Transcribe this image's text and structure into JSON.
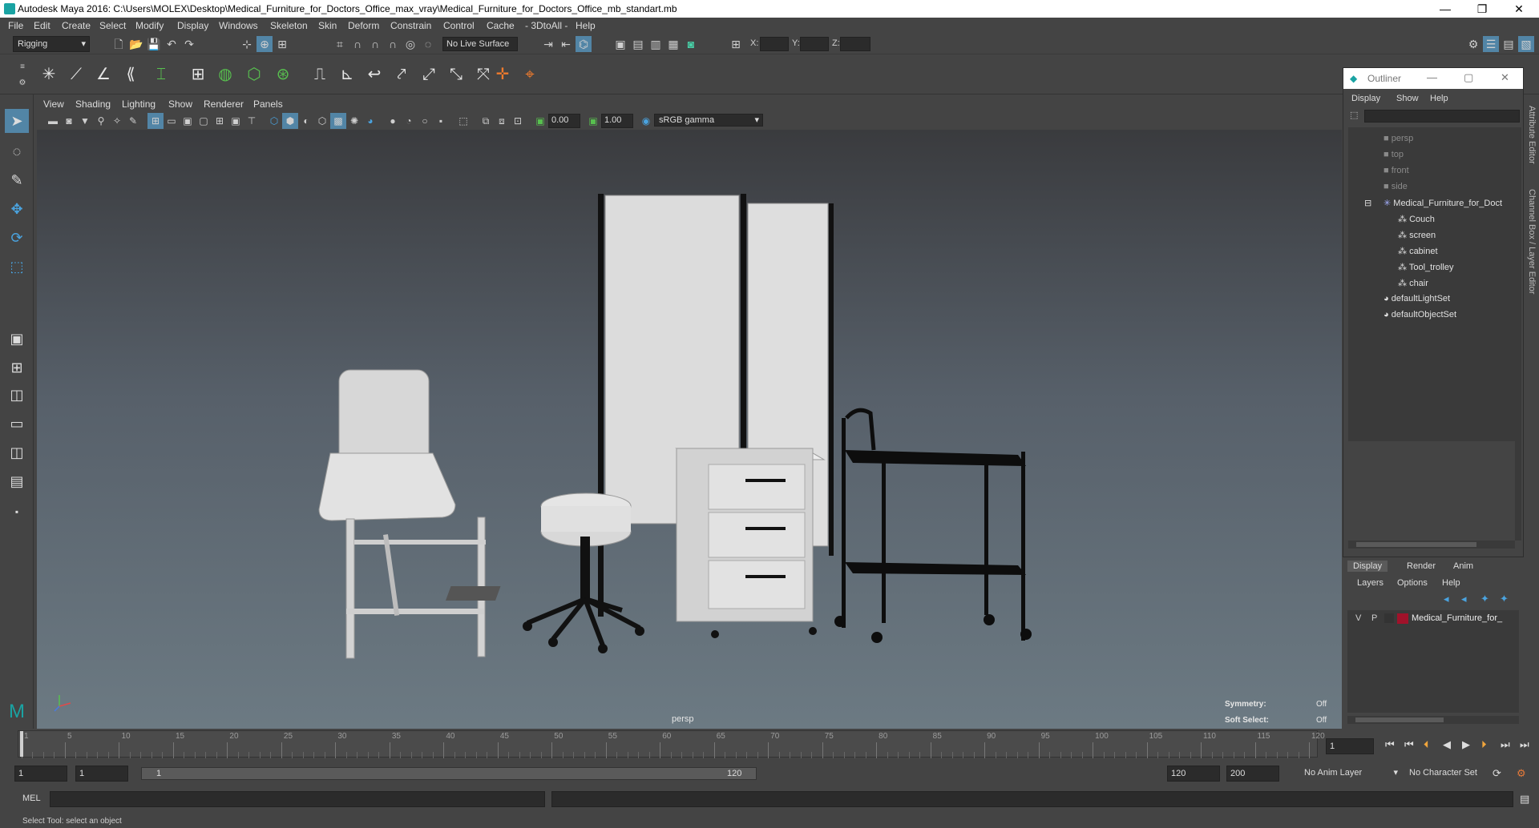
{
  "window": {
    "title": "Autodesk Maya 2016: C:\\Users\\MOLEX\\Desktop\\Medical_Furniture_for_Doctors_Office_max_vray\\Medical_Furniture_for_Doctors_Office_mb_standart.mb",
    "minimize": "—",
    "maximize": "❐",
    "close": "✕"
  },
  "menus": [
    "File",
    "Edit",
    "Create",
    "Select",
    "Modify",
    "Display",
    "Windows",
    "Skeleton",
    "Skin",
    "Deform",
    "Constrain",
    "Control",
    "Cache",
    "- 3DtoAll -",
    "Help"
  ],
  "statusline": {
    "menuset": "Rigging",
    "live_surface": "No Live Surface",
    "x_label": "X:",
    "y_label": "Y:",
    "z_label": "Z:"
  },
  "panel": {
    "menus": [
      "View",
      "Shading",
      "Lighting",
      "Show",
      "Renderer",
      "Panels"
    ],
    "exposure": "0.00",
    "gamma": "1.00",
    "colorspace": "sRGB gamma"
  },
  "viewport": {
    "camera_label": "persp",
    "symmetry_label": "Symmetry:",
    "symmetry_value": "Off",
    "softselect_label": "Soft Select:",
    "softselect_value": "Off"
  },
  "outliner": {
    "title": "Outliner",
    "menus": [
      "Display",
      "Show",
      "Help"
    ],
    "cameras": [
      "persp",
      "top",
      "front",
      "side"
    ],
    "group": "Medical_Furniture_for_Doct",
    "children": [
      "Couch",
      "screen",
      "cabinet",
      "Tool_trolley",
      "chair"
    ],
    "sets": [
      "defaultLightSet",
      "defaultObjectSet"
    ]
  },
  "layers": {
    "tabs": [
      "Display",
      "Render",
      "Anim"
    ],
    "menus": [
      "Layers",
      "Options",
      "Help"
    ],
    "layer_v": "V",
    "layer_p": "P",
    "layer_name": "Medical_Furniture_for_",
    "layer_color": "#a0122a"
  },
  "side_tabs": [
    "Attribute Editor",
    "Channel Box / Layer Editor"
  ],
  "timeline": {
    "ticks": [
      "1",
      "5",
      "10",
      "15",
      "20",
      "25",
      "30",
      "35",
      "40",
      "45",
      "50",
      "55",
      "60",
      "65",
      "70",
      "75",
      "80",
      "85",
      "90",
      "95",
      "100",
      "105",
      "110",
      "115",
      "120"
    ],
    "current_frame": "1"
  },
  "range": {
    "start": "1",
    "playback_start": "1",
    "slider_start": "1",
    "slider_end": "120",
    "playback_end": "120",
    "end": "200",
    "anim_layer": "No Anim Layer",
    "character_set": "No Character Set"
  },
  "mel": {
    "label": "MEL"
  },
  "helpline": {
    "text": "Select Tool: select an object"
  }
}
